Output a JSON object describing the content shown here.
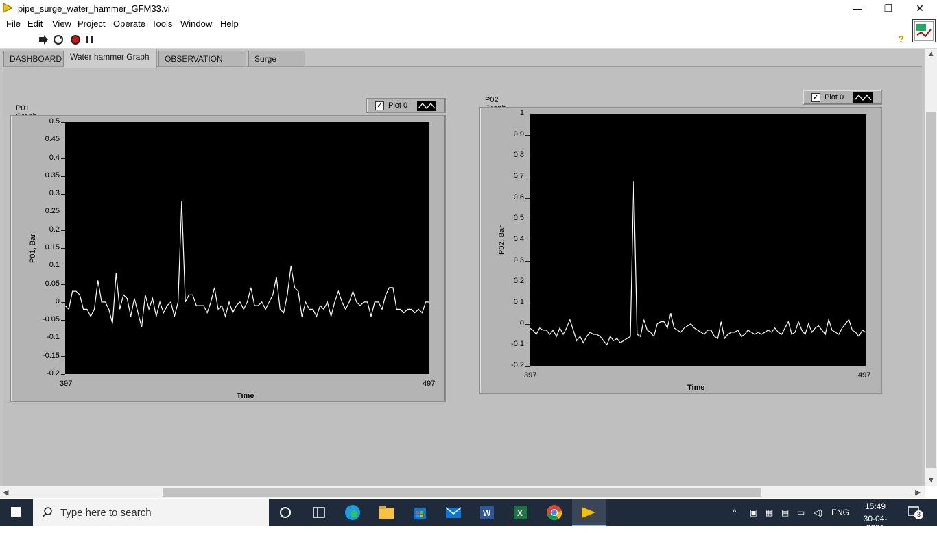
{
  "window": {
    "title": "pipe_surge_water_hammer_GFM33.vi",
    "controls": {
      "minimize": "—",
      "maximize": "❐",
      "close": "✕"
    }
  },
  "menu": [
    "File",
    "Edit",
    "View",
    "Project",
    "Operate",
    "Tools",
    "Window",
    "Help"
  ],
  "toolbar": {
    "icons": [
      "run-arrow-icon",
      "run-continuously-icon",
      "abort-icon",
      "pause-icon"
    ],
    "help": "?"
  },
  "tabs": [
    {
      "label": "DASHBOARD",
      "active": false
    },
    {
      "label": "Water hammer Graph",
      "active": true
    },
    {
      "label": "OBSERVATION TABLE",
      "active": false
    },
    {
      "label": "Surge Graph",
      "active": false
    }
  ],
  "graphs": {
    "p01": {
      "label": "P01 Graph",
      "legend": {
        "plot_name": "Plot 0",
        "checked": true
      },
      "ylabel": "P01, Bar",
      "xlabel": "Time",
      "yticks": [
        "0.5",
        "0.45",
        "0.4",
        "0.35",
        "0.3",
        "0.25",
        "0.2",
        "0.15",
        "0.1",
        "0.05",
        "0",
        "-0.05",
        "-0.1",
        "-0.15",
        "-0.2"
      ],
      "xticks": [
        "397",
        "497"
      ]
    },
    "p02": {
      "label": "P02 Graph",
      "legend": {
        "plot_name": "Plot 0",
        "checked": true
      },
      "ylabel": "P02, Bar",
      "xlabel": "Time",
      "yticks": [
        "1",
        "0.9",
        "0.8",
        "0.7",
        "0.6",
        "0.5",
        "0.4",
        "0.3",
        "0.2",
        "0.1",
        "0",
        "-0.1",
        "-0.2"
      ],
      "xticks": [
        "397",
        "497"
      ]
    }
  },
  "chart_data": [
    {
      "type": "line",
      "ylabel": "P01, Bar",
      "xlabel": "Time",
      "xlim": [
        397,
        497
      ],
      "ylim": [
        -0.2,
        0.5
      ],
      "grid": false,
      "legend": "top-right",
      "series": [
        {
          "name": "Plot 0",
          "color": "#ffffff",
          "x": [
            397,
            398,
            399,
            400,
            401,
            402,
            403,
            404,
            405,
            406,
            407,
            408,
            409,
            410,
            411,
            412,
            413,
            414,
            415,
            416,
            417,
            418,
            419,
            420,
            421,
            422,
            423,
            424,
            425,
            426,
            427,
            428,
            429,
            430,
            431,
            432,
            433,
            434,
            435,
            436,
            437,
            438,
            439,
            440,
            441,
            442,
            443,
            444,
            445,
            446,
            447,
            448,
            449,
            450,
            451,
            452,
            453,
            454,
            455,
            456,
            457,
            458,
            459,
            460,
            461,
            462,
            463,
            464,
            465,
            466,
            467,
            468,
            469,
            470,
            471,
            472,
            473,
            474,
            475,
            476,
            477,
            478,
            479,
            480,
            481,
            482,
            483,
            484,
            485,
            486,
            487,
            488,
            489,
            490,
            491,
            492,
            493,
            494,
            495,
            496,
            497
          ],
          "y": [
            -0.01,
            -0.02,
            0.03,
            0.03,
            0.02,
            -0.02,
            -0.02,
            -0.04,
            -0.02,
            0.06,
            0.0,
            0.0,
            -0.02,
            -0.06,
            0.08,
            -0.02,
            0.02,
            0.01,
            -0.04,
            0.01,
            -0.03,
            -0.07,
            0.02,
            -0.02,
            0.01,
            -0.04,
            0.0,
            -0.03,
            -0.01,
            0.0,
            -0.04,
            0.0,
            0.28,
            0.0,
            0.02,
            0.02,
            -0.01,
            -0.01,
            -0.01,
            -0.03,
            0.0,
            0.04,
            -0.02,
            -0.01,
            -0.04,
            0.0,
            -0.03,
            -0.01,
            0.0,
            -0.02,
            0.0,
            0.04,
            -0.01,
            -0.01,
            0.0,
            -0.02,
            0.0,
            0.02,
            0.07,
            -0.02,
            -0.03,
            0.02,
            0.1,
            0.04,
            0.03,
            -0.04,
            0.0,
            -0.02,
            -0.02,
            -0.04,
            -0.01,
            -0.02,
            0.0,
            -0.04,
            0.0,
            0.03,
            0.0,
            -0.02,
            0.0,
            0.03,
            0.0,
            -0.01,
            0.0,
            0.0,
            -0.04,
            0.0,
            0.0,
            -0.02,
            0.02,
            0.04,
            0.04,
            -0.02,
            -0.02,
            -0.03,
            -0.02,
            -0.02,
            -0.03,
            -0.02,
            -0.03,
            0.0,
            0.0
          ]
        }
      ]
    },
    {
      "type": "line",
      "ylabel": "P02, Bar",
      "xlabel": "Time",
      "xlim": [
        397,
        497
      ],
      "ylim": [
        -0.2,
        1.0
      ],
      "grid": false,
      "legend": "top-right",
      "series": [
        {
          "name": "Plot 0",
          "color": "#ffffff",
          "x": [
            397,
            398,
            399,
            400,
            401,
            402,
            403,
            404,
            405,
            406,
            407,
            408,
            409,
            410,
            411,
            412,
            413,
            414,
            415,
            416,
            417,
            418,
            419,
            420,
            421,
            422,
            423,
            424,
            425,
            426,
            427,
            428,
            429,
            430,
            431,
            432,
            433,
            434,
            435,
            436,
            437,
            438,
            439,
            440,
            441,
            442,
            443,
            444,
            445,
            446,
            447,
            448,
            449,
            450,
            451,
            452,
            453,
            454,
            455,
            456,
            457,
            458,
            459,
            460,
            461,
            462,
            463,
            464,
            465,
            466,
            467,
            468,
            469,
            470,
            471,
            472,
            473,
            474,
            475,
            476,
            477,
            478,
            479,
            480,
            481,
            482,
            483,
            484,
            485,
            486,
            487,
            488,
            489,
            490,
            491,
            492,
            493,
            494,
            495,
            496,
            497
          ],
          "y": [
            -0.02,
            -0.03,
            -0.05,
            -0.02,
            -0.03,
            -0.03,
            -0.05,
            -0.03,
            -0.06,
            -0.02,
            -0.05,
            -0.02,
            0.02,
            -0.03,
            -0.08,
            -0.06,
            -0.09,
            -0.06,
            -0.04,
            -0.05,
            -0.05,
            -0.06,
            -0.08,
            -0.1,
            -0.06,
            -0.08,
            -0.07,
            -0.09,
            -0.08,
            -0.07,
            -0.06,
            0.68,
            -0.05,
            -0.06,
            0.02,
            -0.03,
            -0.04,
            -0.06,
            0.0,
            0.01,
            0.01,
            -0.02,
            0.05,
            -0.02,
            -0.03,
            -0.04,
            -0.02,
            -0.01,
            0.0,
            -0.02,
            -0.03,
            -0.04,
            -0.05,
            -0.03,
            -0.03,
            -0.06,
            -0.07,
            0.01,
            -0.07,
            -0.05,
            -0.04,
            -0.04,
            -0.03,
            -0.06,
            -0.05,
            -0.03,
            -0.04,
            -0.05,
            -0.04,
            -0.05,
            -0.04,
            -0.03,
            -0.04,
            -0.02,
            -0.04,
            -0.05,
            -0.02,
            0.01,
            -0.05,
            -0.04,
            0.01,
            -0.03,
            -0.05,
            0.0,
            -0.04,
            -0.02,
            -0.01,
            -0.03,
            -0.05,
            0.02,
            -0.03,
            -0.04,
            -0.05,
            -0.02,
            0.0,
            0.02,
            -0.03,
            -0.04,
            -0.06,
            -0.03,
            -0.04
          ]
        }
      ]
    }
  ],
  "taskbar": {
    "search_placeholder": "Type here to search",
    "apps": [
      "task-view-icon",
      "widgets-icon",
      "edge-icon",
      "file-explorer-icon",
      "store-icon",
      "mail-icon",
      "word-icon",
      "excel-icon",
      "chrome-icon",
      "labview-icon"
    ],
    "language": "ENG",
    "time": "15:49",
    "date": "30-04-2021",
    "notifications": "3"
  }
}
